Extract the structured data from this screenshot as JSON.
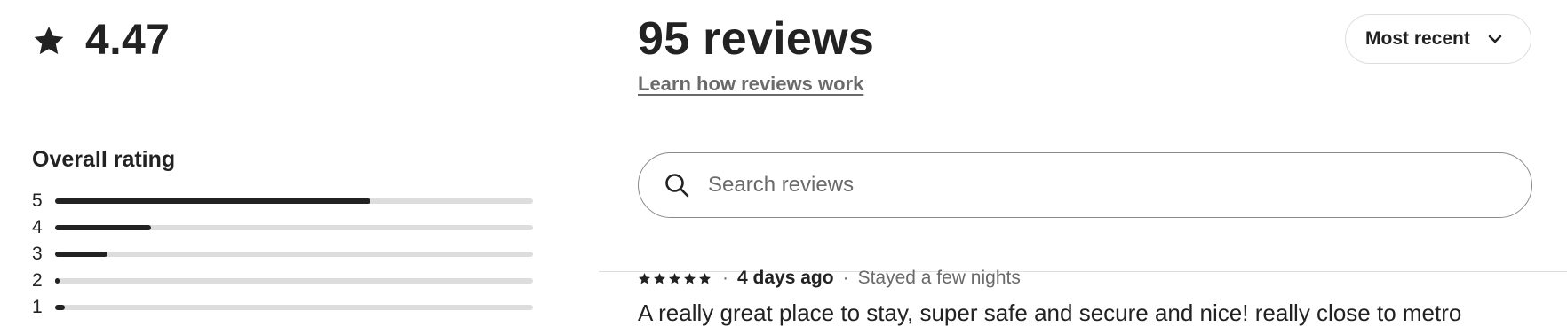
{
  "summary": {
    "rating": "4.47",
    "overall_label": "Overall rating",
    "distribution": [
      {
        "stars": "5",
        "fraction": 0.66
      },
      {
        "stars": "4",
        "fraction": 0.2
      },
      {
        "stars": "3",
        "fraction": 0.11
      },
      {
        "stars": "2",
        "fraction": 0.01
      },
      {
        "stars": "1",
        "fraction": 0.02
      }
    ]
  },
  "header": {
    "review_count": "95 reviews",
    "learn_link": "Learn how reviews work",
    "sort_label": "Most recent"
  },
  "search": {
    "placeholder": "Search reviews",
    "value": ""
  },
  "first_review": {
    "star_count": 5,
    "date": "4 days ago",
    "stay": "Stayed a few nights",
    "separator": "·",
    "text": "A really great place to stay, super safe and secure and nice! really close to metro"
  },
  "icons": {
    "rating": "star-icon",
    "sort": "chevron-down-icon",
    "search": "search-icon"
  },
  "colors": {
    "text": "#222222",
    "muted": "#6a6a6a",
    "bar_track": "#dddddd",
    "bar_fill": "#222222"
  }
}
